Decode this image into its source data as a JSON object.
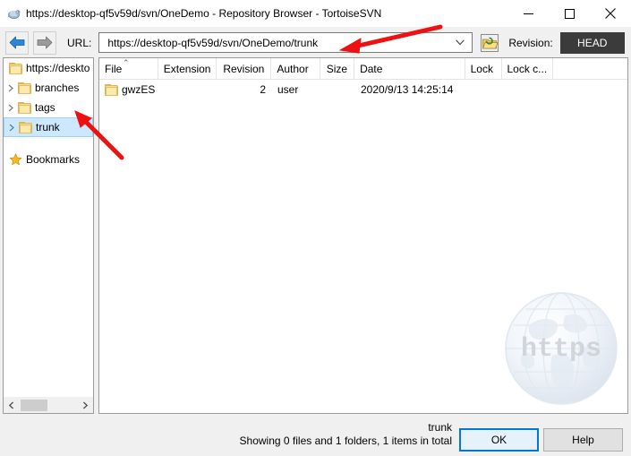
{
  "window": {
    "title": "https://desktop-qf5v59d/svn/OneDemo - Repository Browser - TortoiseSVN",
    "icon": "tortoisesvn-icon",
    "minimize_label": "minimize-icon",
    "maximize_label": "maximize-icon",
    "close_label": "close-icon"
  },
  "toolbar": {
    "back_icon": "back-arrow-icon",
    "forward_icon": "forward-arrow-icon",
    "url_label": "URL:",
    "url_value": "https://desktop-qf5v59d/svn/OneDemo/trunk",
    "url_placeholder": "https://",
    "dropdown_icon": "chevron-down-icon",
    "repo_browser_icon": "repository-folder-icon",
    "revision_label": "Revision:",
    "revision_value": "HEAD"
  },
  "tree": {
    "items": [
      {
        "label": "https://deskto",
        "depth": 0,
        "expander": "",
        "icon": "folder-icon",
        "selected": false
      },
      {
        "label": "branches",
        "depth": 1,
        "expander": "›",
        "icon": "folder-icon",
        "selected": false
      },
      {
        "label": "tags",
        "depth": 1,
        "expander": "›",
        "icon": "folder-icon",
        "selected": false
      },
      {
        "label": "trunk",
        "depth": 1,
        "expander": "›",
        "icon": "folder-icon",
        "selected": true
      }
    ],
    "bookmarks": {
      "label": "Bookmarks",
      "icon": "star-icon"
    },
    "scrollbar": {
      "left_arrow": "scroll-left-icon",
      "right_arrow": "scroll-right-icon"
    }
  },
  "list": {
    "columns": [
      {
        "label": "File",
        "width": 66,
        "align": "left",
        "sorted": true,
        "sort_caret": "⌃"
      },
      {
        "label": "Extension",
        "width": 65,
        "align": "left",
        "sorted": false,
        "sort_caret": ""
      },
      {
        "label": "Revision",
        "width": 62,
        "align": "right",
        "sorted": false,
        "sort_caret": ""
      },
      {
        "label": "Author",
        "width": 55,
        "align": "left",
        "sorted": false,
        "sort_caret": ""
      },
      {
        "label": "Size",
        "width": 38,
        "align": "right",
        "sorted": false,
        "sort_caret": ""
      },
      {
        "label": "Date",
        "width": 124,
        "align": "left",
        "sorted": false,
        "sort_caret": ""
      },
      {
        "label": "Lock",
        "width": 41,
        "align": "left",
        "sorted": false,
        "sort_caret": ""
      },
      {
        "label": "Lock c...",
        "width": 58,
        "align": "left",
        "sorted": false,
        "sort_caret": ""
      }
    ],
    "rows": [
      {
        "icon": "folder-icon",
        "file": "gwzES",
        "extension": "",
        "revision": "2",
        "author": "user",
        "size": "",
        "date": "2020/9/13 14:25:14",
        "lock": "",
        "lock_comment": ""
      }
    ],
    "watermark_text": "https"
  },
  "status": {
    "path": "trunk",
    "summary": "Showing 0 files and 1 folders, 1 items in total"
  },
  "buttons": {
    "ok": "OK",
    "help": "Help"
  },
  "annotations": [
    {
      "name": "url-field-arrow",
      "color": "#ee1111"
    },
    {
      "name": "trunk-node-arrow",
      "color": "#ee1111"
    }
  ],
  "colors": {
    "accent": "#0078d7",
    "selection": "#cce8ff",
    "head_button_bg": "#3b3b3b",
    "annotation_red": "#ee1111",
    "folder_yellow": "#fcdf8f"
  }
}
